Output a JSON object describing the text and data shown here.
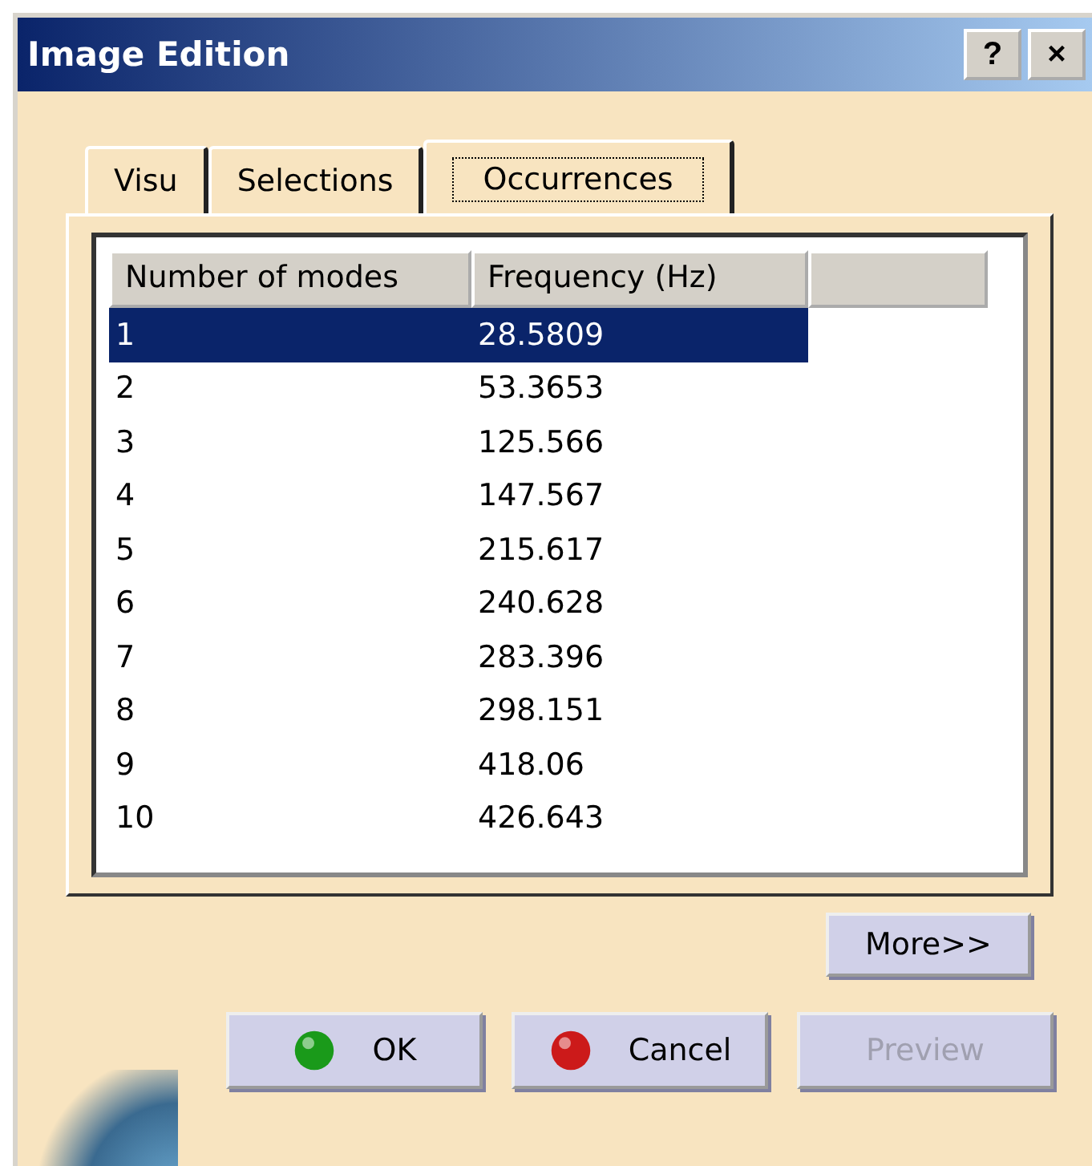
{
  "window": {
    "title": "Image Edition",
    "title_buttons": [
      "?",
      "×"
    ]
  },
  "tabs": [
    {
      "label": "Visu",
      "selected": false
    },
    {
      "label": "Selections",
      "selected": false
    },
    {
      "label": "Occurrences",
      "selected": true
    }
  ],
  "table": {
    "columns": [
      "Number of modes",
      "Frequency (Hz)"
    ],
    "rows": [
      {
        "cells": [
          "1",
          "28.5809"
        ],
        "selected": true
      },
      {
        "cells": [
          "2",
          "53.3653"
        ],
        "selected": false
      },
      {
        "cells": [
          "3",
          "125.566"
        ],
        "selected": false
      },
      {
        "cells": [
          "4",
          "147.567"
        ],
        "selected": false
      },
      {
        "cells": [
          "5",
          "215.617"
        ],
        "selected": false
      },
      {
        "cells": [
          "6",
          "240.628"
        ],
        "selected": false
      },
      {
        "cells": [
          "7",
          "283.396"
        ],
        "selected": false
      },
      {
        "cells": [
          "8",
          "298.151"
        ],
        "selected": false
      },
      {
        "cells": [
          "9",
          "418.06"
        ],
        "selected": false
      },
      {
        "cells": [
          "10",
          "426.643"
        ],
        "selected": false
      }
    ]
  },
  "more_button": {
    "label": "More>>"
  },
  "buttons": [
    {
      "label": "OK",
      "kind": "ok",
      "disabled": false
    },
    {
      "label": "Cancel",
      "kind": "cancel",
      "disabled": false
    },
    {
      "label": "Preview",
      "kind": "plain",
      "disabled": true
    }
  ]
}
